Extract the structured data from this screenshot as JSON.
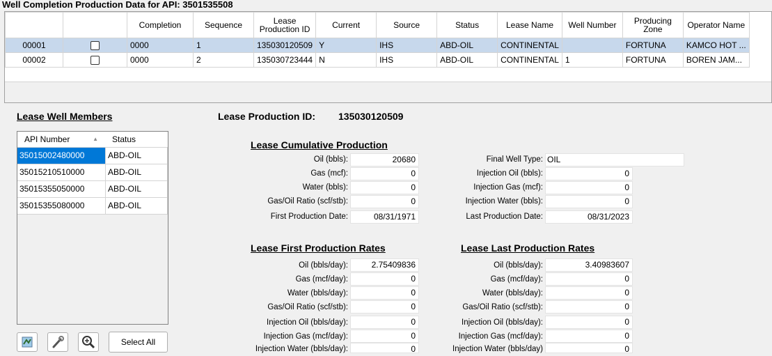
{
  "window": {
    "title": "Well Completion Production Data for API: 3501535508"
  },
  "grid": {
    "headers": [
      "",
      "",
      "Completion",
      "Sequence",
      "Lease Production ID",
      "Current",
      "Source",
      "Status",
      "Lease Name",
      "Well Number",
      "Producing Zone",
      "Operator Name"
    ],
    "rows": [
      {
        "row": "00001",
        "completion": "0000",
        "sequence": "1",
        "lease_id": "135030120509",
        "current": "Y",
        "source": "IHS",
        "status": "ABD-OIL",
        "lease_name": "CONTINENTAL",
        "well_number": "",
        "zone": "FORTUNA",
        "operator": "KAMCO HOT ..."
      },
      {
        "row": "00002",
        "completion": "0000",
        "sequence": "2",
        "lease_id": "135030723444",
        "current": "N",
        "source": "IHS",
        "status": "ABD-OIL",
        "lease_name": "CONTINENTAL",
        "well_number": "1",
        "zone": "FORTUNA",
        "operator": "BOREN JAM..."
      }
    ]
  },
  "members": {
    "heading": "Lease Well Members",
    "col_api": "API Number",
    "col_status": "Status",
    "rows": [
      {
        "api": "35015002480000",
        "status": "ABD-OIL"
      },
      {
        "api": "35015210510000",
        "status": "ABD-OIL"
      },
      {
        "api": "35015355050000",
        "status": "ABD-OIL"
      },
      {
        "api": "35015355080000",
        "status": "ABD-OIL"
      }
    ],
    "select_all": "Select All"
  },
  "lease": {
    "label": "Lease Production ID:",
    "id": "135030120509"
  },
  "cumulative": {
    "heading": "Lease Cumulative Production",
    "oil_label": "Oil (bbls):",
    "oil": "20680",
    "gas_label": "Gas (mcf):",
    "gas": "0",
    "water_label": "Water (bbls):",
    "water": "0",
    "gor_label": "Gas/Oil Ratio (scf/stb):",
    "gor": "0",
    "first_date_label": "First Production Date:",
    "first_date": "08/31/1971",
    "final_type_label": "Final Well Type:",
    "final_type": "OIL",
    "inj_oil_label": "Injection Oil (bbls):",
    "inj_oil": "0",
    "inj_gas_label": "Injection Gas (mcf):",
    "inj_gas": "0",
    "inj_water_label": "Injection Water (bbls):",
    "inj_water": "0",
    "last_date_label": "Last Production Date:",
    "last_date": "08/31/2023"
  },
  "first_rates": {
    "heading": "Lease First Production Rates",
    "oil_label": "Oil (bbls/day):",
    "oil": "2.75409836",
    "gas_label": "Gas (mcf/day):",
    "gas": "0",
    "water_label": "Water (bbls/day):",
    "water": "0",
    "gor_label": "Gas/Oil Ratio (scf/stb):",
    "gor": "0",
    "inj_oil_label": "Injection Oil (bbls/day):",
    "inj_oil": "0",
    "inj_gas_label": "Injection Gas (mcf/day):",
    "inj_gas": "0",
    "inj_water_label": "Injection Water (bbls/day):",
    "inj_water": "0"
  },
  "last_rates": {
    "heading": "Lease Last Production Rates",
    "oil_label": "Oil (bbls/day):",
    "oil": "3.40983607",
    "gas_label": "Gas (mcf/day):",
    "gas": "0",
    "water_label": "Water (bbls/day):",
    "water": "0",
    "gor_label": "Gas/Oil Ratio (scf/stb):",
    "gor": "0",
    "inj_oil_label": "Injection Oil (bbls/day):",
    "inj_oil": "0",
    "inj_gas_label": "Injection Gas (mcf/day):",
    "inj_gas": "0",
    "inj_water_label": "Injection Water (bbls/day)",
    "inj_water": "0"
  },
  "icons": [
    "map-icon",
    "wrench-icon",
    "zoom-in-icon"
  ],
  "colors": {
    "selection": "#c7d8ec",
    "member_selection": "#0078d7"
  }
}
